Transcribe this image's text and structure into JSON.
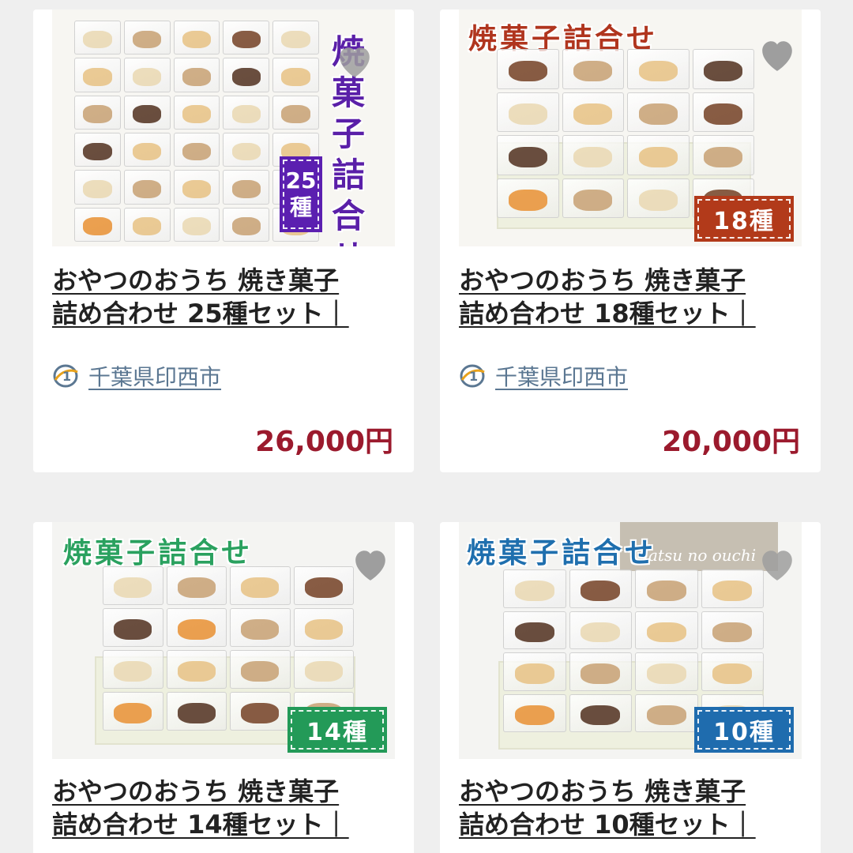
{
  "products": [
    {
      "image_heading": "焼菓子詰合せ",
      "image_heading_lines": [
        "焼",
        "菓",
        "子",
        "詰",
        "合",
        "せ"
      ],
      "badge_lines": [
        "25",
        "種"
      ],
      "title": "おやつのおうち 焼き菓子\n詰め合わせ 25種セット｜",
      "location": "千葉県印西市",
      "price": "26,000円",
      "heading_color": "#5a1fa8",
      "badge_color": "#5b1fb0"
    },
    {
      "image_heading": "焼菓子詰合せ",
      "badge": "18種",
      "title": "おやつのおうち 焼き菓子\n詰め合わせ 18種セット｜",
      "location": "千葉県印西市",
      "price": "20,000円",
      "heading_color": "#b0351e",
      "badge_color": "#b23a1a"
    },
    {
      "image_heading": "焼菓子詰合せ",
      "badge": "14種",
      "title": "おやつのおうち 焼き菓子\n詰め合わせ 14種セット｜",
      "heading_color": "#2aa15f",
      "badge_color": "#239a58"
    },
    {
      "image_heading": "焼菓子詰合せ",
      "badge": "10種",
      "brand_tag": "atsu no ouchi",
      "title": "おやつのおうち 焼き菓子\n詰め合わせ 10種セット｜",
      "heading_color": "#1f6fae",
      "badge_color": "#1f6cae"
    }
  ],
  "colors": {
    "price": "#9b1a2d",
    "location_link": "#5b7792",
    "heart": "#9e9e9e",
    "background": "#efefef"
  },
  "icons": {
    "favorite": "heart-icon",
    "location": "municipality-icon"
  }
}
